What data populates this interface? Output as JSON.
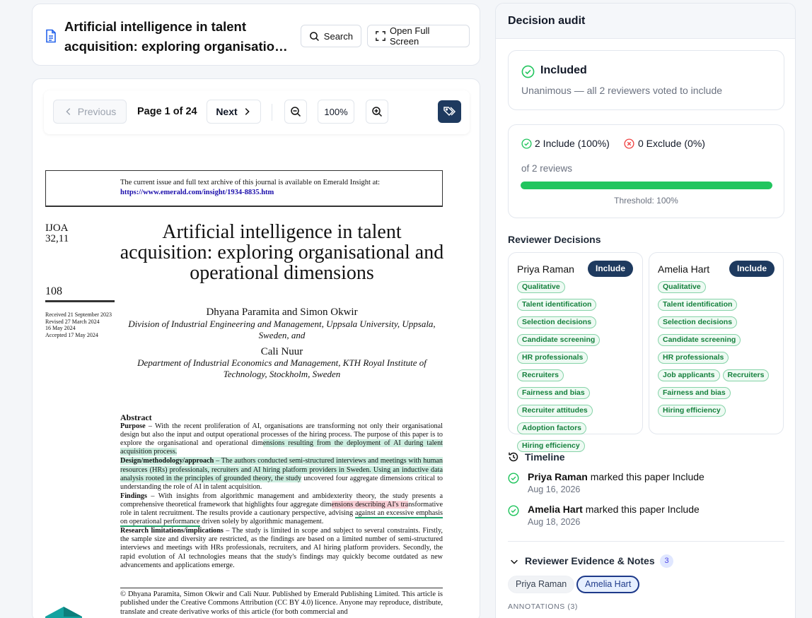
{
  "header": {
    "title_line1": "Artificial intelligence in talent",
    "title_line2": "acquisition: exploring organisation...",
    "search_label": "Search",
    "fullscreen_label": "Open Full Screen"
  },
  "toolbar": {
    "previous_label": "Previous",
    "page_indicator": "Page 1 of 24",
    "next_label": "Next",
    "zoom_level": "100%"
  },
  "pdf": {
    "notice_line1": "The current issue and full text archive of this journal is available on Emerald Insight at:",
    "notice_url": "https://www.emerald.com/insight/1934-8835.htm",
    "journal_code_line1": "IJOA",
    "journal_code_line2": "32,11",
    "page_number": "108",
    "dates": [
      "Received 21 September 2023",
      "Revised 27 March 2024",
      "16 May 2024",
      "Accepted 17 May 2024"
    ],
    "title": "Artificial intelligence in talent acquisition: exploring organisational and operational dimensions",
    "authors": "Dhyana Paramita and Simon Okwir",
    "affiliation1": "Division of Industrial Engineering and Management, Uppsala University, Uppsala, Sweden, and",
    "author3": "Cali Nuur",
    "affiliation2": "Department of Industrial Economics and Management, KTH Royal Institute of Technology, Stockholm, Sweden",
    "abstract_heading": "Abstract",
    "purpose_heading": "Purpose",
    "purpose_text_a": " – With the recent proliferation of AI, organisations are transforming not only their organisational design but also the input and output operational processes of the hiring process. The purpose of this paper is to explore the organisational and operational dim",
    "purpose_text_b": "ensions resulting from the deployment of AI during talent acquisition process.",
    "design_heading": "Design/methodology/approach",
    "design_text_a": " – The authors conducted semi-structured interviews and meetings with human resources (HRs) professionals, recruiters and AI hiring platform providers in Sweden. Using an inductive data analysis rooted in the principles of grounded theory, the study",
    "design_text_b": " uncovered four aggregate dimensions critical to understanding the role of AI in talent acquisition.",
    "findings_heading": "Findings",
    "findings_text_a": " – With insights from algorithmic management and ambidexterity theory, the study presents a comprehensive theoretical framework that highlights four aggregate dim",
    "findings_text_b": "ensions describing AI's tra",
    "findings_text_c": "nsformative role in talent recruitment. The results provide a cautionary perspective, advising ",
    "findings_text_d": "against an excessive emphasis on operational performance",
    "findings_text_e": " driven solely by algorithmic management.",
    "research_heading": "Research limitations/implications",
    "research_text": " – The study is limited in scope and subject to several constraints. Firstly, the sample size and diversity are restricted, as the findings are based on a limited number of semi-structured interviews and meetings with HRs professionals, recruiters, and AI hiring platform providers. Secondly, the rapid evolution of AI technologies means that the study's findings may quickly become outdated as new advancements and applications emerge.",
    "copyright": "© Dhyana Paramita, Simon Okwir and Cali Nuur. Published by Emerald Publishing Limited. This article is published under the Creative Commons Attribution (CC BY 4.0) licence. Anyone may reproduce, distribute, translate and create derivative works of this article (for both commercial and"
  },
  "audit": {
    "panel_title": "Decision audit",
    "status_label": "Included",
    "status_sub": "Unanimous — all 2 reviewers voted to include",
    "include_count": "2 Include (100%)",
    "exclude_count": "0 Exclude (0%)",
    "reviews_of": "of 2 reviews",
    "progress_fraction": 1.0,
    "threshold": "Threshold: 100%",
    "decisions_title": "Reviewer Decisions",
    "reviewers": [
      {
        "name": "Priya Raman",
        "decision": "Include",
        "tags": [
          "Qualitative",
          "Talent identification",
          "Selection decisions",
          "Candidate screening",
          "HR professionals",
          "Recruiters",
          "Fairness and bias",
          "Recruiter attitudes",
          "Adoption factors",
          "Hiring efficiency"
        ]
      },
      {
        "name": "Amelia Hart",
        "decision": "Include",
        "tags": [
          "Qualitative",
          "Talent identification",
          "Selection decisions",
          "Candidate screening",
          "HR professionals",
          "Job applicants",
          "Recruiters",
          "Fairness and bias",
          "Hiring efficiency"
        ]
      }
    ],
    "timeline_title": "Timeline",
    "timeline": [
      {
        "actor": "Priya Raman",
        "action": " marked this paper Include",
        "date": "Aug 16, 2026"
      },
      {
        "actor": "Amelia Hart",
        "action": " marked this paper Include",
        "date": "Aug 18, 2026"
      }
    ],
    "evidence_title": "Reviewer Evidence & Notes",
    "evidence_count": "3",
    "evidence_chips": [
      "Priya Raman",
      "Amelia Hart"
    ],
    "annotations_label": "ANNOTATIONS (3)"
  },
  "colors": {
    "accent_navy": "#1e3a5f",
    "success_green": "#22c55e",
    "exclude_red": "#ef4444",
    "tag_green": "#15803d"
  },
  "icons": {
    "doc": "document-icon",
    "search": "search-icon",
    "fullscreen": "expand-icon",
    "prev": "chevron-left-icon",
    "next": "chevron-right-icon",
    "zoom_out": "zoom-out-icon",
    "zoom_in": "zoom-in-icon",
    "tag": "tags-icon",
    "check": "check-circle-icon",
    "x": "x-circle-icon",
    "history": "history-icon",
    "chevron": "chevron-down-icon"
  }
}
